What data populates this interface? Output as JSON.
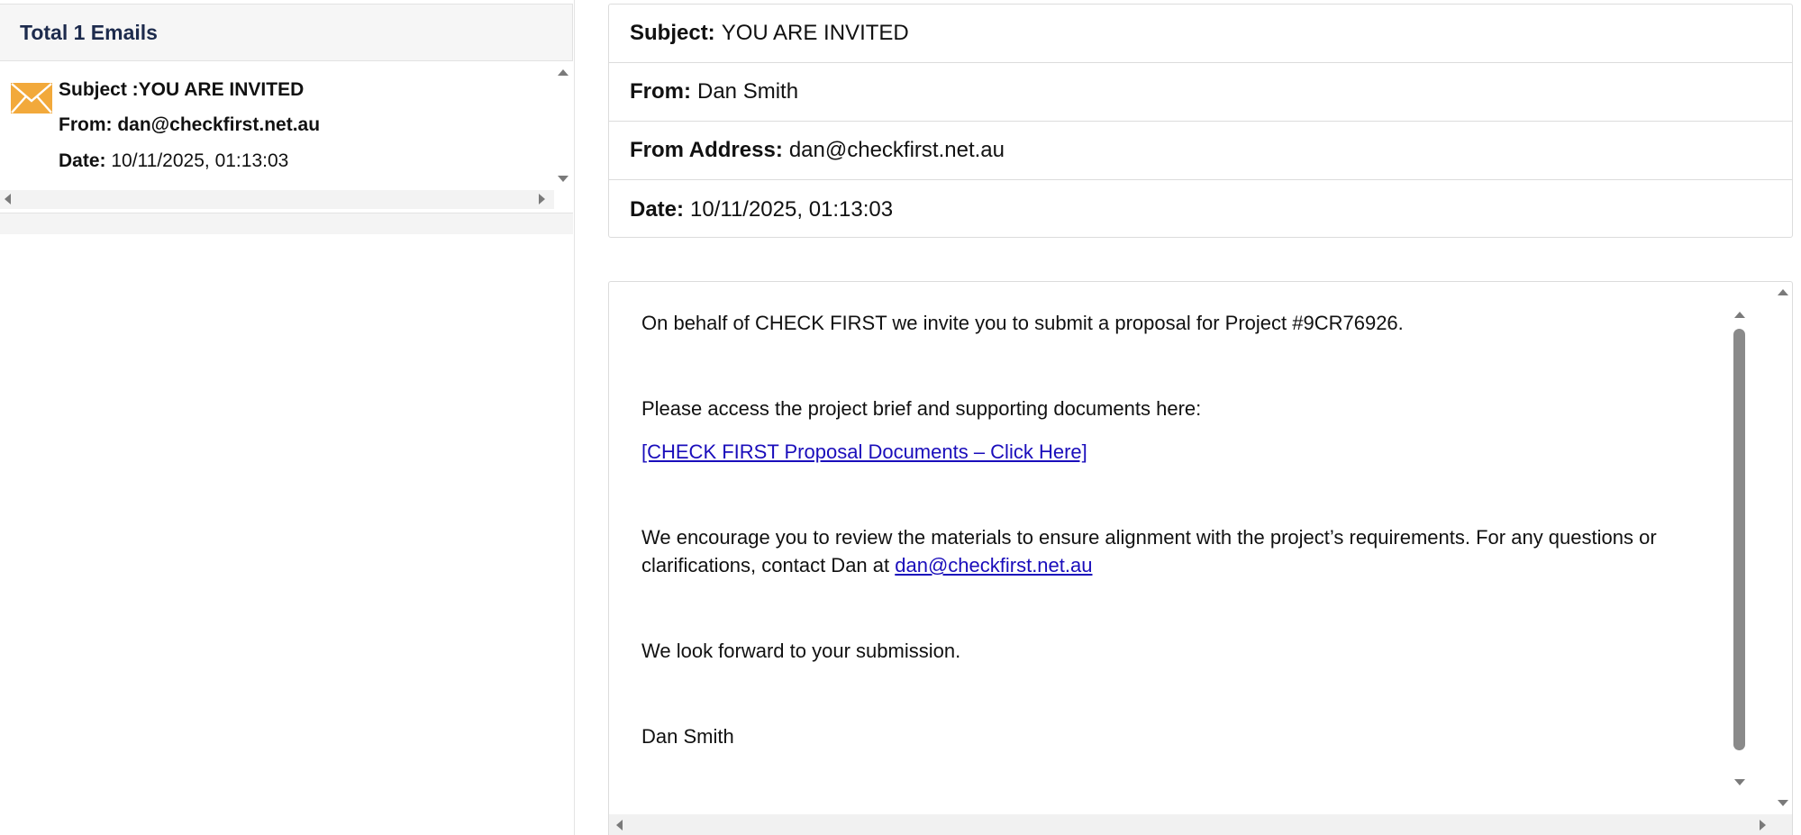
{
  "list_panel": {
    "title": "Total 1 Emails",
    "emails": [
      {
        "subject_text": "Subject :YOU ARE INVITED",
        "from_text": "From: dan@checkfirst.net.au",
        "date_label": "Date:",
        "date_value": "10/11/2025, 01:13:03",
        "icon": "envelope-icon"
      }
    ]
  },
  "header": {
    "subject_label": "Subject:",
    "subject_value": "YOU ARE INVITED",
    "from_label": "From:",
    "from_value": "Dan Smith",
    "from_address_label": "From Address:",
    "from_address_value": "dan@checkfirst.net.au",
    "date_label": "Date:",
    "date_value": "10/11/2025, 01:13:03"
  },
  "body": {
    "p1": "On behalf of  CHECK FIRST we invite you to submit a proposal for Project #9CR76926.",
    "p2": "Please access the project brief and supporting documents here:",
    "link_text": "[CHECK FIRST Proposal Documents – Click Here]",
    "p3_line1": "We encourage you to review the materials to ensure alignment with the project’s requirements. For any questions or",
    "p3_line2_prefix": "clarifications, contact Dan at ",
    "p3_email": "dan@checkfirst.net.au",
    "p4": "We look forward to your submission.",
    "signature": "Dan Smith"
  },
  "colors": {
    "envelope": "#f2a93b",
    "link": "#1a0dab",
    "list_title": "#1d2b4d",
    "scroll_thumb": "#8a8a8a"
  }
}
